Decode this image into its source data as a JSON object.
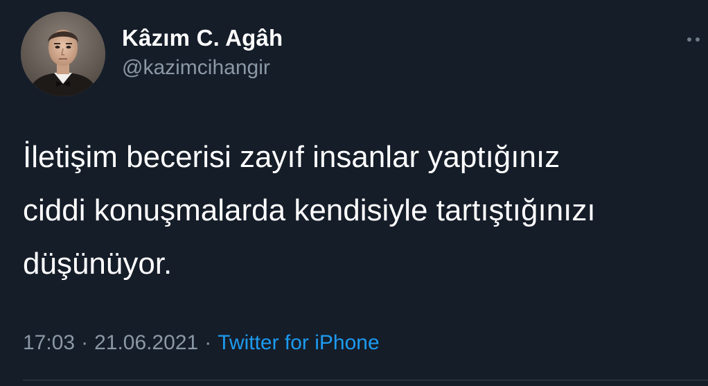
{
  "author": {
    "display_name": "Kâzım C. Agâh",
    "handle": "@kazimcihangir",
    "avatar_icon": "profile-photo"
  },
  "tweet": {
    "lines": [
      "İletişim becerisi zayıf insanlar yaptığınız",
      "ciddi konuşmalarda kendisiyle tartıştığınızı",
      "düşünüyor."
    ]
  },
  "meta": {
    "time": "17:03",
    "separator": "·",
    "date": "21.06.2021",
    "source": "Twitter for iPhone"
  },
  "menu": {
    "icon": "more-dots-icon"
  },
  "colors": {
    "background": "#151d29",
    "text": "#ffffff",
    "secondary_text": "#8b98a5",
    "link": "#1d9bf0"
  }
}
